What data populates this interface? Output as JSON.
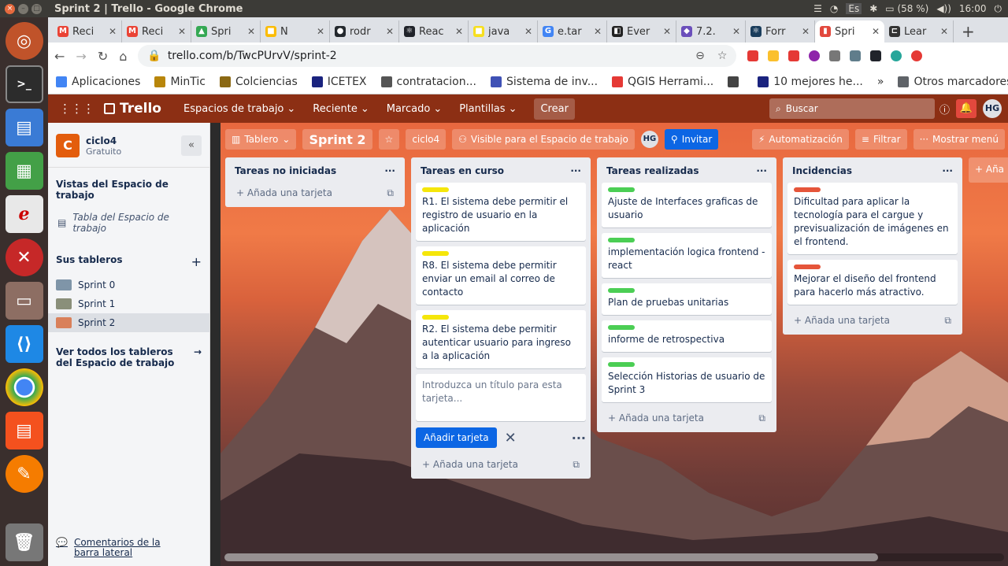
{
  "os": {
    "window_title": "Sprint 2 | Trello - Google Chrome",
    "battery": "(58 %)",
    "time": "16:00",
    "lang": "Es"
  },
  "chrome": {
    "tabs": [
      {
        "label": "Reci",
        "color": "#ea4335",
        "glyph": "M"
      },
      {
        "label": "Reci",
        "color": "#ea4335",
        "glyph": "M"
      },
      {
        "label": "Spri",
        "color": "#34a853",
        "glyph": "▲"
      },
      {
        "label": "N",
        "color": "#fbbc04",
        "glyph": "■"
      },
      {
        "label": "rodr",
        "color": "#24292e",
        "glyph": "●"
      },
      {
        "label": "Reac",
        "color": "#20232a",
        "glyph": "⚛"
      },
      {
        "label": "java",
        "color": "#f7df1e",
        "glyph": "■"
      },
      {
        "label": "e.tar",
        "color": "#4285f4",
        "glyph": "G"
      },
      {
        "label": "Ever",
        "color": "#222",
        "glyph": "◧"
      },
      {
        "label": "7.2.",
        "color": "#6b4fbb",
        "glyph": "◆"
      },
      {
        "label": "Forr",
        "color": "#1a3d5c",
        "glyph": "⚛"
      },
      {
        "label": "Spri",
        "color": "#e2483d",
        "glyph": "▮"
      },
      {
        "label": "Lear",
        "color": "#333",
        "glyph": "⊏"
      }
    ],
    "url": "trello.com/b/TwcPUrvV/sprint-2",
    "bookmarks": [
      {
        "label": "Aplicaciones",
        "color": "#4285f4"
      },
      {
        "label": "MinTic",
        "color": "#b8860b"
      },
      {
        "label": "Colciencias",
        "color": "#8b6914"
      },
      {
        "label": "ICETEX",
        "color": "#1a237e"
      },
      {
        "label": "contratacion...",
        "color": "#555"
      },
      {
        "label": "Sistema de inv...",
        "color": "#3f51b5"
      },
      {
        "label": "QGIS Herrami...",
        "color": "#e53935"
      },
      {
        "label": "",
        "color": "#444"
      },
      {
        "label": "10 mejores he...",
        "color": "#1a237e"
      }
    ],
    "other_bookmarks": "Otros marcadores"
  },
  "header": {
    "logo": "Trello",
    "menus": [
      "Espacios de trabajo",
      "Reciente",
      "Marcado",
      "Plantillas"
    ],
    "create": "Crear",
    "search_placeholder": "Buscar",
    "avatar": "HG"
  },
  "sidebar": {
    "workspace_initial": "C",
    "workspace_name": "ciclo4",
    "workspace_plan": "Gratuito",
    "views_title": "Vistas del Espacio de trabajo",
    "views": [
      "Tabla del Espacio de trabajo"
    ],
    "boards_title": "Sus tableros",
    "boards": [
      {
        "label": "Sprint 0",
        "color": "#7f95a8"
      },
      {
        "label": "Sprint 1",
        "color": "#8a8f7a"
      },
      {
        "label": "Sprint 2",
        "color": "#d9805a"
      }
    ],
    "see_all": "Ver todos los tableros del Espacio de trabajo",
    "feedback": "Comentarios de la barra lateral"
  },
  "board": {
    "view": "Tablero",
    "title": "Sprint 2",
    "workspace": "ciclo4",
    "visibility": "Visible para el Espacio de trabajo",
    "member": "HG",
    "invite": "Invitar",
    "automation": "Automatización",
    "filter": "Filtrar",
    "menu": "Mostrar menú",
    "add_list": "+ Aña",
    "add_card": "Añada una tarjeta",
    "composer_placeholder": "Introduzca un título para esta tarjeta...",
    "composer_submit": "Añadir tarjeta",
    "lists": [
      {
        "title": "Tareas no iniciadas",
        "cards": []
      },
      {
        "title": "Tareas en curso",
        "cards": [
          {
            "label_color": "#f5e60a",
            "text": "R1. El sistema debe permitir el registro de usuario en la aplicación"
          },
          {
            "label_color": "#f5e60a",
            "text": "R8. El sistema debe permitir enviar un email al correo de contacto"
          },
          {
            "label_color": "#f5e60a",
            "text": "R2. El sistema debe permitir autenticar usuario para ingreso a la aplicación"
          }
        ]
      },
      {
        "title": "Tareas realizadas",
        "cards": [
          {
            "label_color": "#4bce54",
            "text": "Ajuste de Interfaces graficas de usuario"
          },
          {
            "label_color": "#4bce54",
            "text": "implementación logica frontend - react"
          },
          {
            "label_color": "#4bce54",
            "text": "Plan de pruebas unitarias"
          },
          {
            "label_color": "#4bce54",
            "text": "informe de retrospectiva"
          },
          {
            "label_color": "#4bce54",
            "text": "Selección Historias de usuario de Sprint 3"
          }
        ]
      },
      {
        "title": "Incidencias",
        "cards": [
          {
            "label_color": "#e5553a",
            "text": "Dificultad para aplicar la tecnología para el cargue y previsualización de imágenes en el frontend."
          },
          {
            "label_color": "#e5553a",
            "text": "Mejorar el diseño del frontend para hacerlo más atractivo."
          }
        ]
      }
    ]
  }
}
